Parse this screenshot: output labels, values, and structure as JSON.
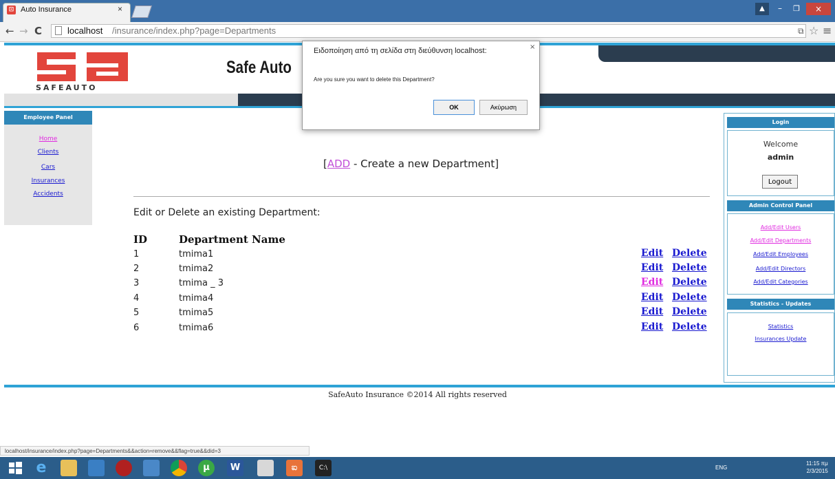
{
  "browser": {
    "tab_title": "Auto Insurance",
    "tab_close": "×",
    "url_host": "localhost",
    "url_path": "/insurance/index.php?page=Departments",
    "status_url": "localhost/insurance/index.php?page=Departments&&action=remove&&flag=true&&did=3"
  },
  "header": {
    "logo_text": "SAFEAUTO",
    "site_title": "Safe Auto",
    "brand_red": "#e2453c",
    "accent_blue": "#2fa3d6"
  },
  "left_panel": {
    "title": "Employee Panel",
    "links": [
      "Home",
      "Clients",
      "Cars",
      "Insurances",
      "Accidents"
    ]
  },
  "main": {
    "add_link": "ADD",
    "add_text": " - Create a new Department]",
    "add_bracket": "[",
    "edit_heading": "Edit or Delete an existing Department:",
    "col_id": "ID",
    "col_name": "Department Name",
    "edit_label": "Edit",
    "delete_label": "Delete",
    "rows": [
      {
        "id": "1",
        "name": "tmima1"
      },
      {
        "id": "2",
        "name": "tmima2"
      },
      {
        "id": "3",
        "name": "tmima _ 3"
      },
      {
        "id": "4",
        "name": "tmima4"
      },
      {
        "id": "5",
        "name": "tmima5"
      },
      {
        "id": "6",
        "name": "tmima6"
      }
    ]
  },
  "right_panel": {
    "login_title": "Login",
    "welcome": "Welcome",
    "username": "admin",
    "logout": "Logout",
    "admin_title": "Admin Control Panel",
    "admin_links": [
      "Add/Edit Users",
      "Add/Edit Departments",
      "Add/Edit Employees",
      "Add/Edit Directors",
      "Add/Edit Categories"
    ],
    "stats_title": "Statistics - Updates",
    "stats_links": [
      "Statistics",
      "Insurances Update"
    ]
  },
  "footer": {
    "text": "SafeAuto Insurance ©2014 All rights reserved"
  },
  "dialog": {
    "title": "Ειδοποίηση από τη σελίδα στη διεύθυνση localhost:",
    "message": "Are you sure you want to delete this Department?",
    "ok": "OK",
    "cancel": "Ακύρωση",
    "close": "×"
  },
  "taskbar": {
    "language": "ENG",
    "time": "11:15 πμ",
    "date": "2/3/2015"
  }
}
